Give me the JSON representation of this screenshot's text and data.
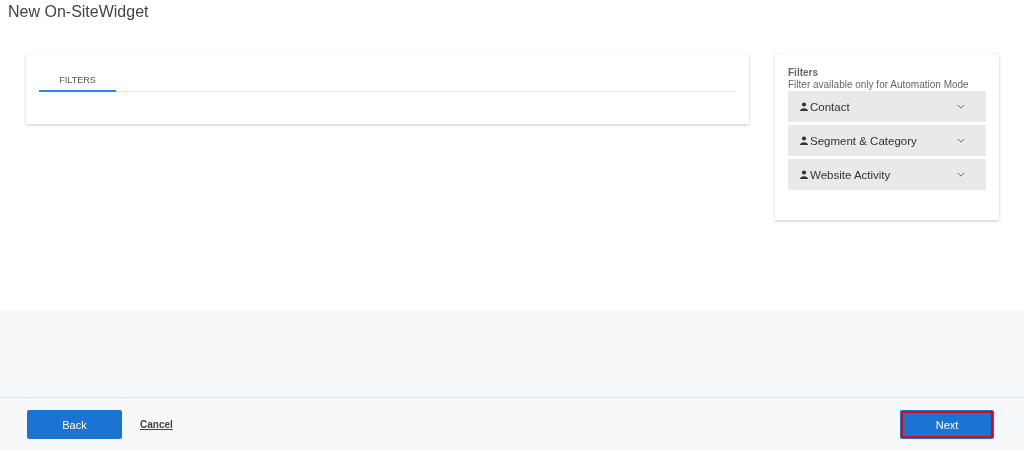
{
  "page": {
    "title": "New On-SiteWidget"
  },
  "tabs": [
    {
      "label": "FILTERS",
      "selected": true
    }
  ],
  "filters_panel": {
    "title": "Filters",
    "subtitle": "Filter available only for Automation Mode",
    "items": [
      {
        "label": "Contact",
        "expanded": false
      },
      {
        "label": "Segment & Category",
        "expanded": false
      },
      {
        "label": "Website Activity",
        "expanded": false
      }
    ]
  },
  "footer": {
    "back": "Back",
    "cancel": "Cancel",
    "next": {
      "label": "Next",
      "highlighted": true
    }
  }
}
